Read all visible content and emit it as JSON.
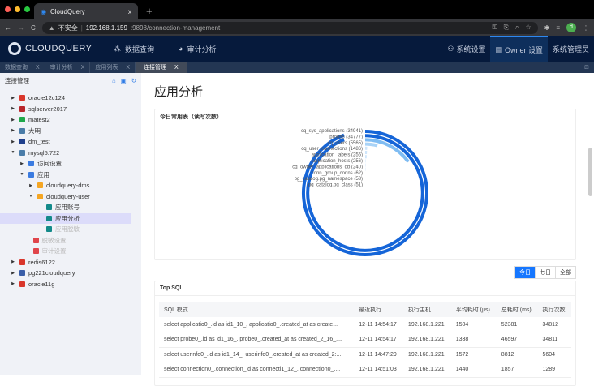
{
  "browser": {
    "tab_title": "CloudQuery",
    "tab_close": "x",
    "new_tab": "+",
    "insecure": "不安全",
    "host": "192.168.1.159",
    "path": ":9898/connection-management",
    "avatar": "d"
  },
  "app": {
    "logo": "CLOUDQUERY",
    "nav": [
      "数据查询",
      "审计分析"
    ],
    "right": [
      "系统设置",
      "Owner 设置",
      "系统管理员"
    ]
  },
  "page_tabs": [
    {
      "label": "数据查询",
      "close": "X"
    },
    {
      "label": "审计分析",
      "close": "X"
    },
    {
      "label": "应用列表",
      "close": "X"
    },
    {
      "label": "连接管理",
      "close": "X"
    }
  ],
  "sidebar": {
    "title": "连接管理",
    "nodes": [
      {
        "label": "oracle12c124",
        "level": 0,
        "arrow": "▶",
        "color": "#d9362b"
      },
      {
        "label": "sqlserver2017",
        "level": 0,
        "arrow": "▶",
        "color": "#b8262b"
      },
      {
        "label": "matest2",
        "level": 0,
        "arrow": "▶",
        "color": "#1fa84a"
      },
      {
        "label": "大明",
        "level": 0,
        "arrow": "▶",
        "color": "#4a7ca8"
      },
      {
        "label": "dm_test",
        "level": 0,
        "arrow": "▶",
        "color": "#1f3f8c"
      },
      {
        "label": "mysql5.722",
        "level": 0,
        "arrow": "▼",
        "color": "#4a7ca8"
      },
      {
        "label": "访问设置",
        "level": 1,
        "arrow": "▶",
        "color": "#3b7be0"
      },
      {
        "label": "应用",
        "level": 1,
        "arrow": "▼",
        "color": "#3b7be0"
      },
      {
        "label": "cloudquery-dms",
        "level": 2,
        "arrow": "▶",
        "color": "#f5a623"
      },
      {
        "label": "cloudquery-user",
        "level": 2,
        "arrow": "▼",
        "color": "#f5a623"
      },
      {
        "label": "应用账号",
        "level": 3,
        "arrow": "",
        "color": "#138a8a"
      },
      {
        "label": "应用分析",
        "level": 3,
        "arrow": "",
        "color": "#138a8a",
        "selected": true
      },
      {
        "label": "应用脱敏",
        "level": 3,
        "arrow": "",
        "color": "#138a8a",
        "disabled": true
      },
      {
        "label": "脱敏设置",
        "level": 1.5,
        "arrow": "",
        "color": "#e0454b",
        "disabled": true
      },
      {
        "label": "审计设置",
        "level": 1.5,
        "arrow": "",
        "color": "#e0454b",
        "disabled": true
      },
      {
        "label": "redis6122",
        "level": 0,
        "arrow": "▶",
        "color": "#d9362b"
      },
      {
        "label": "pg221cloudquery",
        "level": 0,
        "arrow": "▶",
        "color": "#3a5ea8"
      },
      {
        "label": "oracle11g",
        "level": 0,
        "arrow": "▶",
        "color": "#d9362b"
      }
    ]
  },
  "main": {
    "title": "应用分析",
    "chart_card_title": "今日常用表（读写次数）",
    "range_buttons": [
      "今日",
      "七日",
      "全部"
    ],
    "top_sql_title": "Top SQL"
  },
  "chart_data": {
    "type": "bar",
    "subtype": "polar-radial",
    "title": "今日常用表（读写次数）",
    "categories": [
      "cq_sys_applications",
      "probes",
      "cq_users",
      "cq_user_connections",
      "application_labels",
      "application_hosts",
      "cq_owner_applications_db",
      "conn_group_conns",
      "pg_catalog.pg_namespace",
      "pg_catalog.pg_class"
    ],
    "values": [
      34941,
      34777,
      5565,
      1486,
      256,
      256,
      240,
      62,
      53,
      51
    ],
    "colors": [
      "#1565d8",
      "#1565d8",
      "#7fbcf2",
      "#a9d3f7",
      "#cfe6fb",
      "#cfe6fb",
      "#cfe6fb",
      "#e3f0fc",
      "#e3f0fc",
      "#e3f0fc"
    ]
  },
  "top_sql": {
    "columns": [
      "SQL 模式",
      "最近执行",
      "执行主机",
      "平均耗时 (μs)",
      "总耗时 (ms)",
      "执行次数"
    ],
    "rows": [
      [
        "select applicatio0_.id as id1_10_, applicatio0_.created_at as create...",
        "12-11 14:54:17",
        "192.168.1.221",
        "1504",
        "52381",
        "34812"
      ],
      [
        "select probe0_.id as id1_16_, probe0_.created_at as created_2_16_,...",
        "12-11 14:54:17",
        "192.168.1.221",
        "1338",
        "46597",
        "34811"
      ],
      [
        "select userinfo0_.id as id1_14_, userinfo0_.created_at as created_2:...",
        "12-11 14:47:29",
        "192.168.1.221",
        "1572",
        "8812",
        "5604"
      ],
      [
        "select connection0_.connection_id as connecti1_12_, connection0_....",
        "12-11 14:51:03",
        "192.168.1.221",
        "1440",
        "1857",
        "1289"
      ]
    ]
  }
}
